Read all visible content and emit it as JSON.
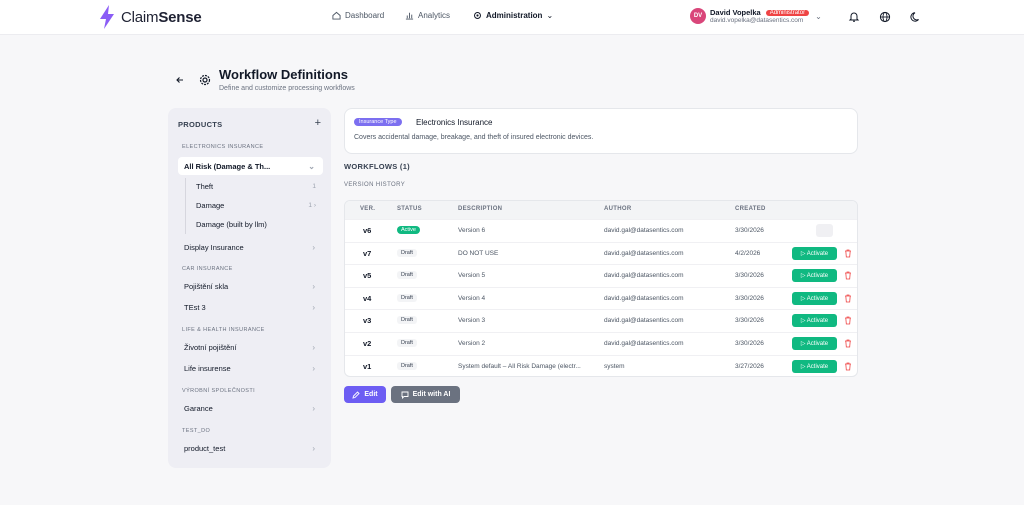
{
  "app": {
    "name_regular": "Claim",
    "name_bold": "Sense",
    "accent": "#7c5cff"
  },
  "nav": {
    "dashboard": "Dashboard",
    "analytics": "Analytics",
    "administration": "Administration"
  },
  "user": {
    "initials": "DV",
    "name": "David Vopelka",
    "role": "Administrator",
    "email": "david.vopelka@datasentics.com"
  },
  "header": {
    "title": "Workflow Definitions",
    "subtitle": "Define and customize processing workflows"
  },
  "sidebar": {
    "heading": "PRODUCTS",
    "sections": [
      {
        "label": "ELECTRONICS INSURANCE"
      },
      {
        "label": "CAR INSURANCE"
      },
      {
        "label": "LIFE & HEALTH INSURANCE"
      },
      {
        "label": "VÝROBNÍ SPOLEČNOSTI"
      },
      {
        "label": "TEST_DO"
      }
    ],
    "items": {
      "all_risk": "All Risk (Damage & Th...",
      "theft": "Theft",
      "theft_count": "1",
      "damage": "Damage",
      "damage_count": "1",
      "damage_llm": "Damage (built by llm)",
      "display": "Display Insurance",
      "pojisteni_skla": "Pojištění skla",
      "test3": "TEst 3",
      "zivotni": "Životní pojištění",
      "life": "Life insurense",
      "garance": "Garance",
      "product_test": "product_test"
    }
  },
  "insurance": {
    "badge": "Insurance Type",
    "name": "Electronics Insurance",
    "description": "Covers accidental damage, breakage, and theft of insured electronic devices."
  },
  "workflows": {
    "heading": "WORKFLOWS (1)",
    "version_history": "VERSION HISTORY"
  },
  "table": {
    "headers": {
      "ver": "VER.",
      "status": "STATUS",
      "description": "DESCRIPTION",
      "author": "AUTHOR",
      "created": "CREATED"
    },
    "activate_label": "▷ Activate",
    "rows": [
      {
        "ver": "v6",
        "status": "Active",
        "description": "Version 6",
        "author": "david.gal@datasentics.com",
        "created": "3/30/2026"
      },
      {
        "ver": "v7",
        "status": "Draft",
        "description": "DO NOT USE",
        "author": "david.gal@datasentics.com",
        "created": "4/2/2026"
      },
      {
        "ver": "v5",
        "status": "Draft",
        "description": "Version 5",
        "author": "david.gal@datasentics.com",
        "created": "3/30/2026"
      },
      {
        "ver": "v4",
        "status": "Draft",
        "description": "Version 4",
        "author": "david.gal@datasentics.com",
        "created": "3/30/2026"
      },
      {
        "ver": "v3",
        "status": "Draft",
        "description": "Version 3",
        "author": "david.gal@datasentics.com",
        "created": "3/30/2026"
      },
      {
        "ver": "v2",
        "status": "Draft",
        "description": "Version 2",
        "author": "david.gal@datasentics.com",
        "created": "3/30/2026"
      },
      {
        "ver": "v1",
        "status": "Draft",
        "description": "System default – All Risk Damage (electr...",
        "author": "system",
        "created": "3/27/2026"
      }
    ]
  },
  "buttons": {
    "edit": "Edit",
    "edit_ai": "Edit with AI"
  }
}
